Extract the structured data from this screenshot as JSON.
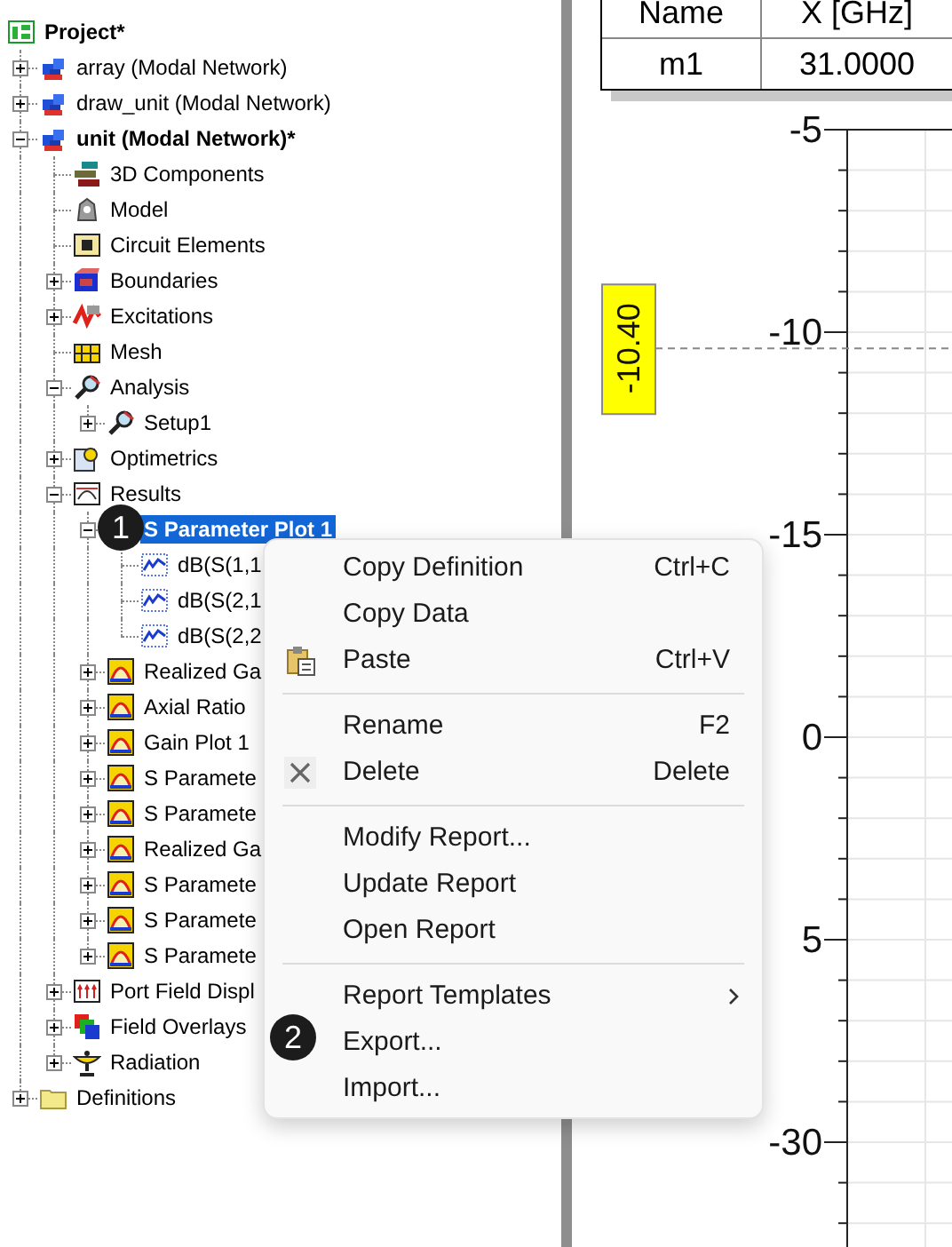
{
  "tree": {
    "label": "Project*",
    "kind": "project",
    "bold": true,
    "selected": false,
    "children": [
      {
        "label": "array (Modal Network)",
        "kind": "design",
        "bold": false,
        "selected": false,
        "expanded": false
      },
      {
        "label": "draw_unit (Modal Network)",
        "kind": "design",
        "bold": false,
        "selected": false,
        "expanded": false
      },
      {
        "label": "unit (Modal Network)*",
        "kind": "design",
        "bold": true,
        "selected": false,
        "expanded": true,
        "children": [
          {
            "label": "3D Components",
            "kind": "components",
            "bold": false,
            "selected": false
          },
          {
            "label": "Model",
            "kind": "model",
            "bold": false,
            "selected": false
          },
          {
            "label": "Circuit Elements",
            "kind": "circuit",
            "bold": false,
            "selected": false
          },
          {
            "label": "Boundaries",
            "kind": "boundaries",
            "bold": false,
            "selected": false,
            "expanded": false
          },
          {
            "label": "Excitations",
            "kind": "excitations",
            "bold": false,
            "selected": false,
            "expanded": false
          },
          {
            "label": "Mesh",
            "kind": "mesh",
            "bold": false,
            "selected": false
          },
          {
            "label": "Analysis",
            "kind": "analysis",
            "bold": false,
            "selected": false,
            "expanded": true,
            "children": [
              {
                "label": "Setup1",
                "kind": "analysis",
                "bold": false,
                "selected": false,
                "expanded": false
              }
            ]
          },
          {
            "label": "Optimetrics",
            "kind": "optimetrics",
            "bold": false,
            "selected": false,
            "expanded": false
          },
          {
            "label": "Results",
            "kind": "results",
            "bold": false,
            "selected": false,
            "expanded": true,
            "children": [
              {
                "label": "S Parameter Plot 1",
                "kind": "report",
                "bold": true,
                "selected": true,
                "expanded": true,
                "children": [
                  {
                    "label": "dB(S(1,1",
                    "kind": "trace",
                    "bold": false,
                    "selected": false
                  },
                  {
                    "label": "dB(S(2,1",
                    "kind": "trace",
                    "bold": false,
                    "selected": false
                  },
                  {
                    "label": "dB(S(2,2",
                    "kind": "trace",
                    "bold": false,
                    "selected": false
                  }
                ]
              },
              {
                "label": "Realized Ga",
                "kind": "report",
                "bold": false,
                "selected": false,
                "expanded": false
              },
              {
                "label": "Axial Ratio",
                "kind": "report",
                "bold": false,
                "selected": false,
                "expanded": false
              },
              {
                "label": "Gain Plot 1",
                "kind": "report",
                "bold": false,
                "selected": false,
                "expanded": false
              },
              {
                "label": "S Paramete",
                "kind": "report",
                "bold": false,
                "selected": false,
                "expanded": false
              },
              {
                "label": "S Paramete",
                "kind": "report",
                "bold": false,
                "selected": false,
                "expanded": false
              },
              {
                "label": "Realized Ga",
                "kind": "report",
                "bold": false,
                "selected": false,
                "expanded": false
              },
              {
                "label": "S Paramete",
                "kind": "report",
                "bold": false,
                "selected": false,
                "expanded": false
              },
              {
                "label": "S Paramete",
                "kind": "report",
                "bold": false,
                "selected": false,
                "expanded": false
              },
              {
                "label": "S Paramete",
                "kind": "report",
                "bold": false,
                "selected": false,
                "expanded": false
              }
            ]
          },
          {
            "label": "Port Field Displ",
            "kind": "port",
            "bold": false,
            "selected": false,
            "expanded": false
          },
          {
            "label": "Field Overlays",
            "kind": "overlays",
            "bold": false,
            "selected": false,
            "expanded": false
          },
          {
            "label": "Radiation",
            "kind": "radiation",
            "bold": false,
            "selected": false,
            "expanded": false
          }
        ]
      },
      {
        "label": "Definitions",
        "kind": "folder",
        "bold": false,
        "selected": false,
        "expanded": false
      }
    ]
  },
  "context_menu": [
    {
      "kind": "plain",
      "label": "Copy Definition",
      "shortcut": "Ctrl+C"
    },
    {
      "kind": "plain",
      "label": "Copy Data"
    },
    {
      "kind": "clipboard",
      "label": "Paste",
      "shortcut": "Ctrl+V"
    },
    {
      "kind": "separator"
    },
    {
      "kind": "plain",
      "label": "Rename",
      "shortcut": "F2"
    },
    {
      "kind": "remove",
      "label": "Delete",
      "shortcut": "Delete"
    },
    {
      "kind": "separator"
    },
    {
      "kind": "plain",
      "label": "Modify Report..."
    },
    {
      "kind": "plain",
      "label": "Update Report"
    },
    {
      "kind": "plain",
      "label": "Open Report"
    },
    {
      "kind": "separator"
    },
    {
      "kind": "submenu",
      "label": "Report Templates"
    },
    {
      "kind": "plain",
      "label": "Export..."
    },
    {
      "kind": "plain",
      "label": "Import..."
    }
  ],
  "step_badges": [
    {
      "label": "1"
    },
    {
      "label": "2"
    }
  ],
  "marker_table": {
    "columns": [
      "Name",
      "X [GHz]"
    ],
    "rows": [
      [
        "m1",
        "31.0000"
      ]
    ]
  },
  "plot": {
    "y_axis_labels": [
      "-5",
      "-10",
      "-15",
      "0",
      "5",
      "-30"
    ],
    "marker_value": "-10.40"
  }
}
